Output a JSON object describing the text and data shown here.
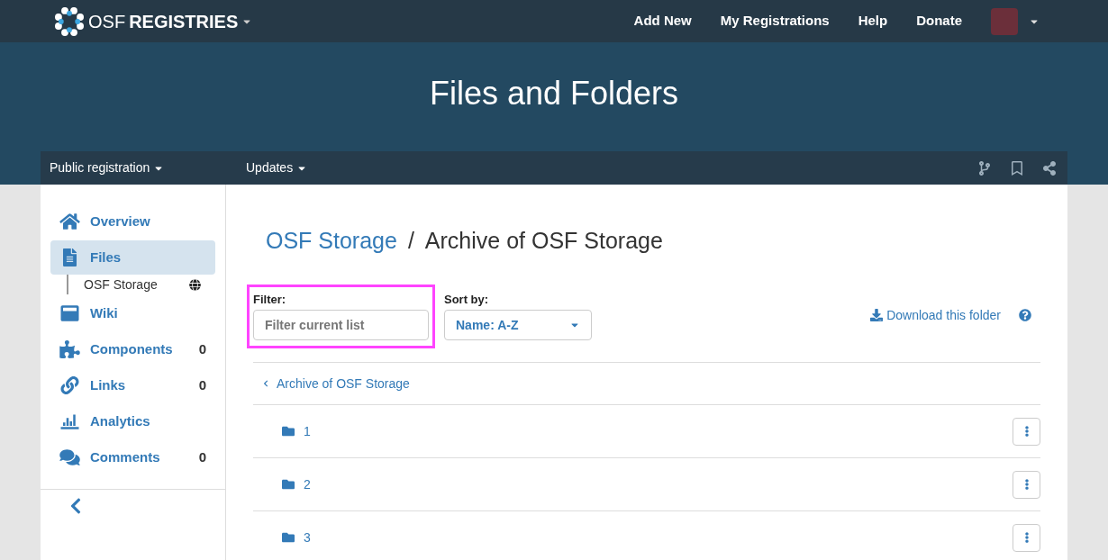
{
  "navbar": {
    "brand_light": "OSF",
    "brand_bold": "REGISTRIES",
    "links": [
      "Add New",
      "My Registrations",
      "Help",
      "Donate"
    ]
  },
  "hero": {
    "title": "Files and Folders"
  },
  "subnav": {
    "menus": [
      "Public registration",
      "Updates"
    ]
  },
  "sidebar": {
    "items": [
      {
        "label": "Overview",
        "selected": false
      },
      {
        "label": "Files",
        "selected": true,
        "children": [
          {
            "label": "OSF Storage"
          }
        ]
      },
      {
        "label": "Wiki",
        "selected": false
      },
      {
        "label": "Components",
        "selected": false,
        "count": "0"
      },
      {
        "label": "Links",
        "selected": false,
        "count": "0"
      },
      {
        "label": "Analytics",
        "selected": false
      },
      {
        "label": "Comments",
        "selected": false,
        "count": "0"
      }
    ]
  },
  "breadcrumb": {
    "link": "OSF Storage",
    "separator": "/",
    "current": "Archive of OSF Storage"
  },
  "filter": {
    "label": "Filter:",
    "placeholder": "Filter current list",
    "highlighted": true
  },
  "sort": {
    "label": "Sort by:",
    "value": "Name: A-Z"
  },
  "download": "Download this folder",
  "files": {
    "parent": "Archive of OSF Storage",
    "rows": [
      {
        "name": "1"
      },
      {
        "name": "2"
      },
      {
        "name": "3"
      }
    ]
  }
}
